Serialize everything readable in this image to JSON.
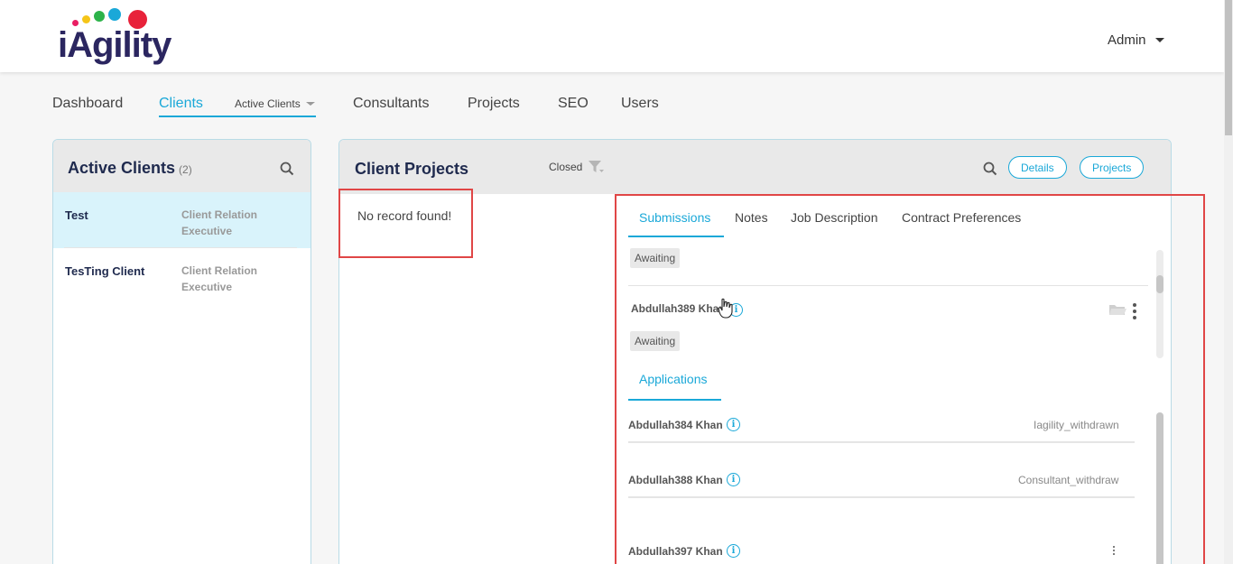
{
  "header": {
    "logo_text": "iAgility",
    "logo_colors": [
      "#e91e63",
      "#f5c518",
      "#2db34a",
      "#1aa8d8",
      "#e8223a"
    ],
    "user_label": "Admin"
  },
  "nav": {
    "items": [
      {
        "label": "Dashboard"
      },
      {
        "label": "Clients"
      },
      {
        "label": "Consultants"
      },
      {
        "label": "Projects"
      },
      {
        "label": "SEO"
      },
      {
        "label": "Users"
      }
    ],
    "clients_sub_label": "Active Clients",
    "accent_color": "#1aa8d8"
  },
  "active_clients": {
    "title": "Active Clients",
    "count": "(2)",
    "items": [
      {
        "name": "Test",
        "role_line1": "Client Relation",
        "role_line2": "Executive"
      },
      {
        "name": "TesTing Client",
        "role_line1": "Client Relation",
        "role_line2": "Executive"
      }
    ]
  },
  "client_projects": {
    "title": "Client Projects",
    "filter_label": "Closed",
    "details_button": "Details",
    "projects_button": "Projects",
    "empty_message": "No record found!"
  },
  "detail": {
    "tabs": [
      {
        "label": "Submissions"
      },
      {
        "label": "Notes"
      },
      {
        "label": "Job Description"
      },
      {
        "label": "Contract Preferences"
      }
    ],
    "submissions": [
      {
        "status": "Awaiting"
      },
      {
        "name": "Abdullah389 Khan",
        "status": "Awaiting"
      }
    ],
    "applications_tab": "Applications",
    "applications": [
      {
        "name": "Abdullah384 Khan",
        "status": "Iagility_withdrawn"
      },
      {
        "name": "Abdullah388 Khan",
        "status": "Consultant_withdraw"
      },
      {
        "name": "Abdullah397 Khan",
        "status": ""
      }
    ]
  }
}
